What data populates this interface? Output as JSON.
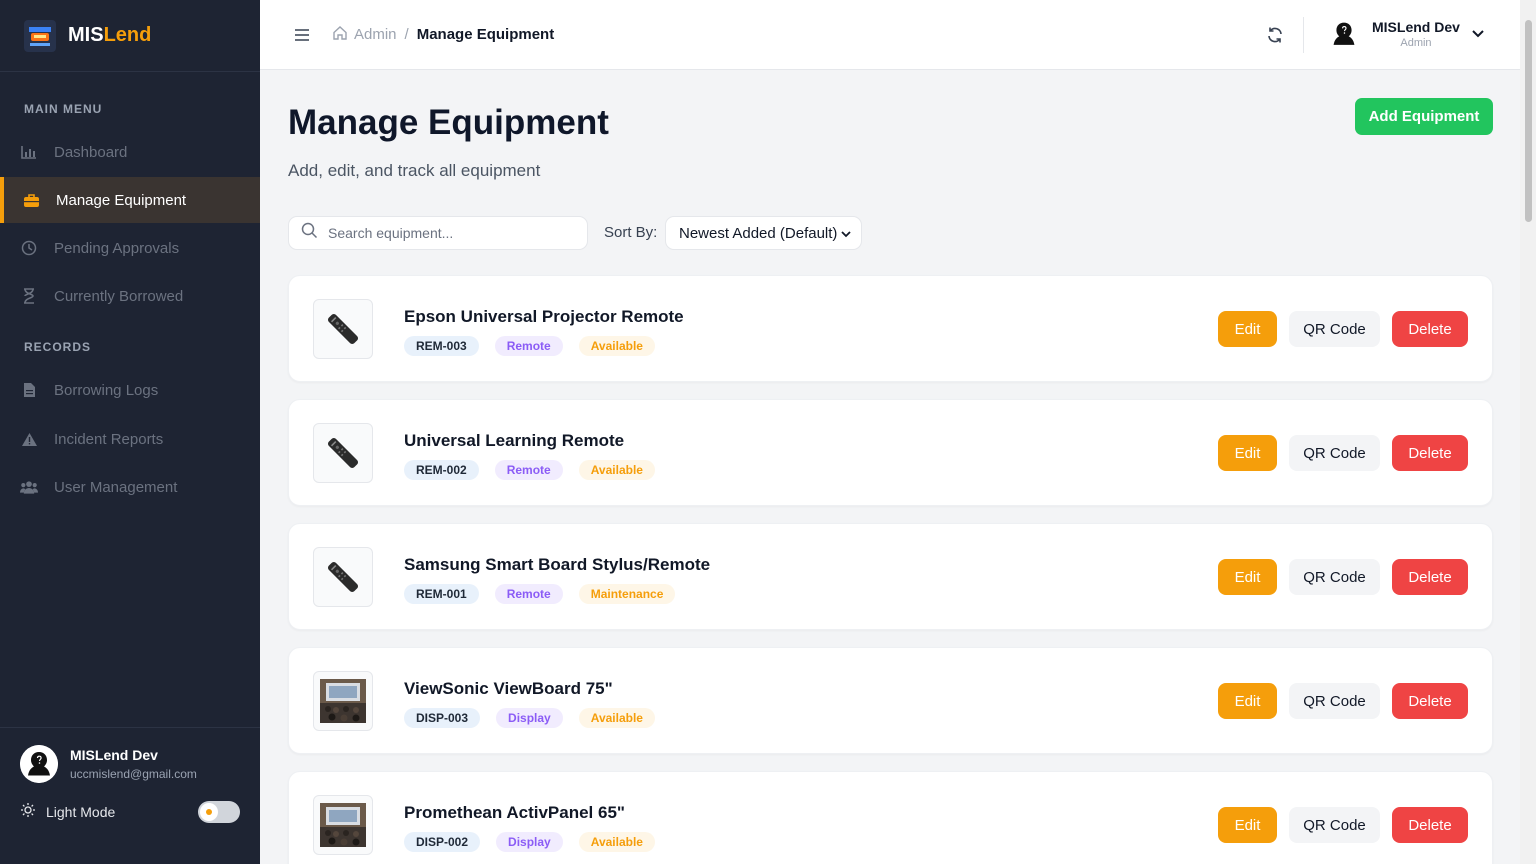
{
  "brand": {
    "prefix": "MIS",
    "suffix": "Lend"
  },
  "sidebar": {
    "main_menu_label": "MAIN MENU",
    "records_label": "RECORDS",
    "main_items": [
      {
        "label": "Dashboard",
        "icon": "bar-chart-icon"
      },
      {
        "label": "Manage Equipment",
        "icon": "briefcase-icon"
      },
      {
        "label": "Pending Approvals",
        "icon": "clock-icon"
      },
      {
        "label": "Currently Borrowed",
        "icon": "hourglass-icon"
      }
    ],
    "record_items": [
      {
        "label": "Borrowing Logs",
        "icon": "document-icon"
      },
      {
        "label": "Incident Reports",
        "icon": "warning-icon"
      },
      {
        "label": "User Management",
        "icon": "users-icon"
      }
    ],
    "active_item": "Manage Equipment",
    "user": {
      "name": "MISLend Dev",
      "email": "uccmislend@gmail.com"
    },
    "mode_label": "Light Mode"
  },
  "topbar": {
    "breadcrumb_root": "Admin",
    "breadcrumb_separator": "/",
    "breadcrumb_current": "Manage Equipment",
    "user_name": "MISLend Dev",
    "user_role": "Admin"
  },
  "page": {
    "title": "Manage Equipment",
    "subtitle": "Add, edit, and track all equipment",
    "add_button": "Add Equipment",
    "search_placeholder": "Search equipment...",
    "sort_label": "Sort By:",
    "sort_value": "Newest Added (Default)"
  },
  "actions": {
    "edit": "Edit",
    "qr": "QR Code",
    "delete": "Delete"
  },
  "equipment": [
    {
      "name": "Epson Universal Projector Remote",
      "code": "REM-003",
      "category": "Remote",
      "status": "Available",
      "thumb": "remote"
    },
    {
      "name": "Universal Learning Remote",
      "code": "REM-002",
      "category": "Remote",
      "status": "Available",
      "thumb": "remote"
    },
    {
      "name": "Samsung Smart Board Stylus/Remote",
      "code": "REM-001",
      "category": "Remote",
      "status": "Maintenance",
      "thumb": "remote"
    },
    {
      "name": "ViewSonic ViewBoard 75\"",
      "code": "DISP-003",
      "category": "Display",
      "status": "Available",
      "thumb": "classroom"
    },
    {
      "name": "Promethean ActivPanel 65\"",
      "code": "DISP-002",
      "category": "Display",
      "status": "Available",
      "thumb": "classroom"
    }
  ],
  "colors": {
    "sidebar_bg": "#1e2433",
    "accent": "#f59e0b",
    "add_button": "#22c55e",
    "edit_button": "#f59e0b",
    "delete_button": "#ef4444"
  }
}
